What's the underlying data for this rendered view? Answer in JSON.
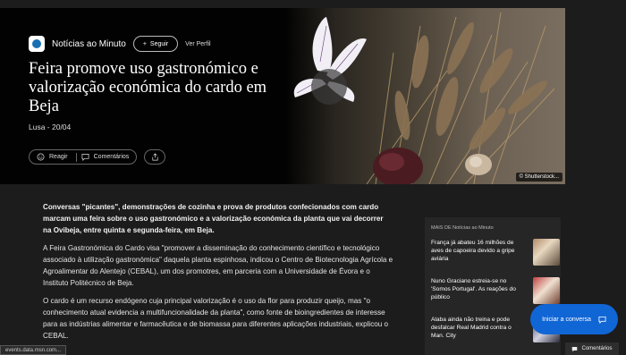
{
  "hero": {
    "publisher": "Notícias ao Minuto",
    "follow_label": "Seguir",
    "profile_label": "Ver Perfil",
    "headline": "Feira promove uso gastronómico e valorização económica do cardo em Beja",
    "byline": "Lusa - 20/04",
    "react_label": "Reagir",
    "comments_label": "Comentários",
    "photo_credit": "© Shutterstock..."
  },
  "article": {
    "paragraphs": [
      "Conversas \"picantes\", demonstrações de cozinha e prova de produtos confecionados com cardo marcam uma feira sobre o uso gastronómico e a valorização económica da planta que vai decorrer na Ovibeja, entre quinta e segunda-feira, em Beja.",
      "A Feira Gastronómica do Cardo visa \"promover a disseminação do conhecimento científico e tecnológico associado à utilização gastronómica\" daquela planta espinhosa, indicou o Centro de Biotecnologia Agrícola e Agroalimentar do Alentejo (CEBAL), um dos promotres, em parceria com a Universidade de Évora e o Instituto Politécnico de Beja.",
      "O cardo é um recurso endógeno cuja principal valorização é o uso da flor para produzir queijo, mas \"o conhecimento atual evidencia a multifuncionalidade da planta\", como fonte de bioingredientes de interesse para as indústrias alimentar e farmacêutica e de biomassa para diferentes aplicações industriais, explicou o CEBAL."
    ]
  },
  "sidebar": {
    "title": "MAIS DE Notícias ao Minuto",
    "items": [
      {
        "title": "França já abateu 16 milhões de aves de capoeira devido a gripe aviária"
      },
      {
        "title": "Nuno Graciano estreia-se no 'Somos Portugal'. As reações do público"
      },
      {
        "title": "Alaba ainda não treina e pode desfalcar Real Madrid contra o Man. City"
      }
    ]
  },
  "chat": {
    "label": "Iniciar a conversa"
  },
  "comments_bar": {
    "label": "Comentários"
  },
  "status_url": "events.data.msn.com...",
  "colors": {
    "accent": "#1166d6",
    "background": "#1c1c1c"
  }
}
